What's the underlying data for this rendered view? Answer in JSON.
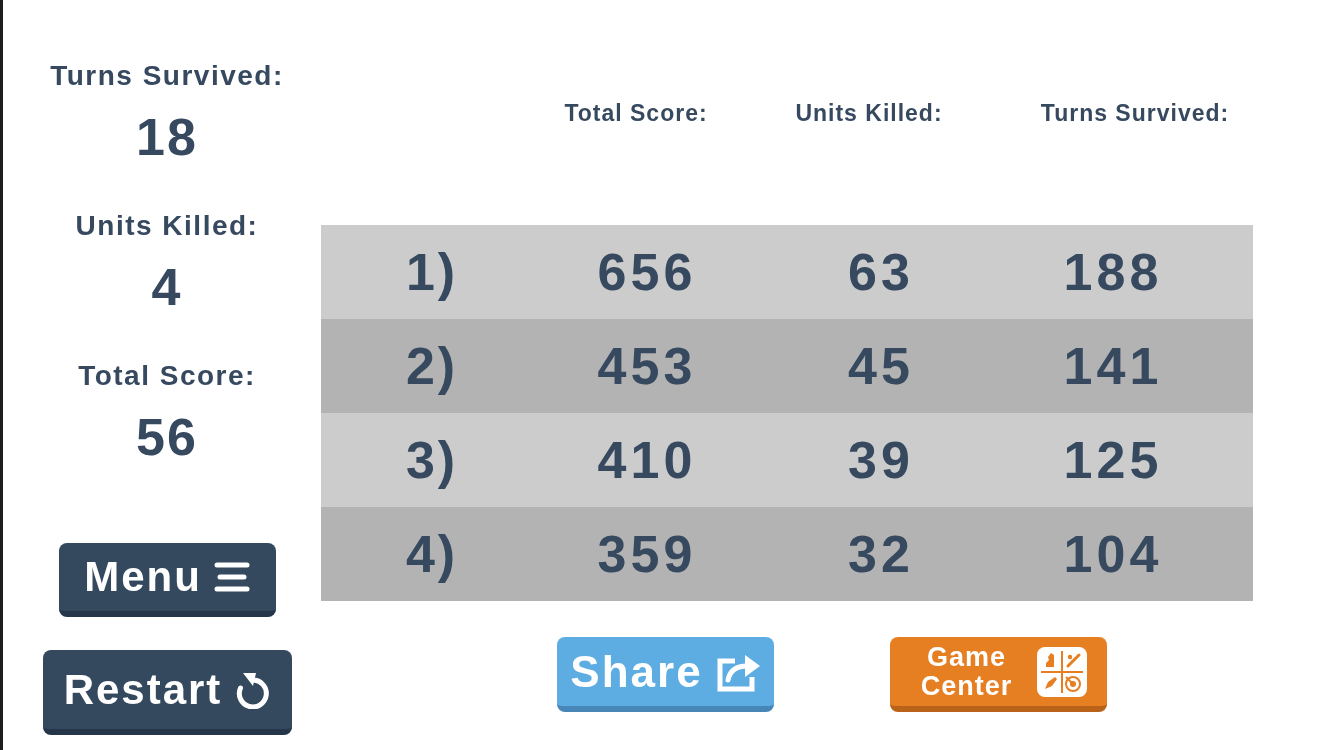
{
  "summary": [
    {
      "label": "Turns Survived:",
      "value": "18"
    },
    {
      "label": "Units Killed:",
      "value": "4"
    },
    {
      "label": "Total Score:",
      "value": "56"
    }
  ],
  "side_buttons": [
    {
      "kind": "menu",
      "label": "Menu"
    },
    {
      "kind": "restart",
      "label": "Restart"
    }
  ],
  "leaderboard": {
    "columns": [
      "Total Score:",
      "Units Killed:",
      "Turns Survived:"
    ],
    "rows": [
      {
        "rank": "1)",
        "cells": [
          "656",
          "63",
          "188"
        ]
      },
      {
        "rank": "2)",
        "cells": [
          "453",
          "45",
          "141"
        ]
      },
      {
        "rank": "3)",
        "cells": [
          "410",
          "39",
          "125"
        ]
      },
      {
        "rank": "4)",
        "cells": [
          "359",
          "32",
          "104"
        ]
      }
    ]
  },
  "actions": [
    {
      "kind": "share",
      "label": "Share"
    },
    {
      "kind": "game_center",
      "label": "Game Center"
    }
  ]
}
